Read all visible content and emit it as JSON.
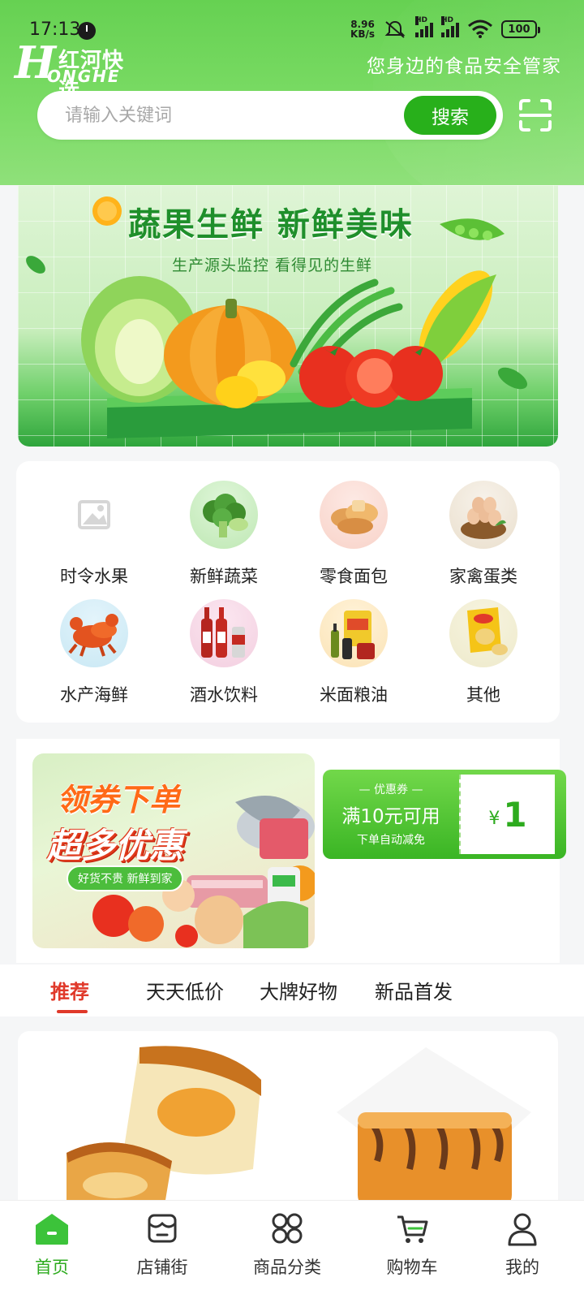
{
  "status_bar": {
    "time": "17:13",
    "net_speed_value": "8.96",
    "net_speed_unit": "KB/s",
    "battery": "100"
  },
  "header": {
    "logo_cn": "红河快选",
    "logo_en": "ONGHE",
    "logo_letter": "H",
    "slogan": "您身边的食品安全管家",
    "search_placeholder": "请输入关键词",
    "search_button": "搜索"
  },
  "banner": {
    "title": "蔬果生鲜 新鲜美味",
    "subtitle": "生产源头监控  看得见的生鲜"
  },
  "categories": [
    {
      "label": "时令水果",
      "icon": "image-placeholder-icon"
    },
    {
      "label": "新鲜蔬菜",
      "icon": "broccoli-icon"
    },
    {
      "label": "零食面包",
      "icon": "bread-icon"
    },
    {
      "label": "家禽蛋类",
      "icon": "eggs-icon"
    },
    {
      "label": "水产海鲜",
      "icon": "crab-icon"
    },
    {
      "label": "酒水饮料",
      "icon": "beer-bottles-icon"
    },
    {
      "label": "米面粮油",
      "icon": "rice-oil-icon"
    },
    {
      "label": "其他",
      "icon": "chips-icon"
    }
  ],
  "promo": {
    "line1": "领券下单",
    "line2": "超多优惠",
    "tag": "好货不贵 新鲜到家"
  },
  "coupon": {
    "kicker": "— 优惠券 —",
    "condition": "满10元可用",
    "note": "下单自动减免",
    "currency": "¥",
    "amount": "1"
  },
  "tabs": [
    {
      "label": "推荐",
      "active": true
    },
    {
      "label": "天天低价",
      "active": false
    },
    {
      "label": "大牌好物",
      "active": false
    },
    {
      "label": "新品首发",
      "active": false
    }
  ],
  "bottom_nav": [
    {
      "label": "首页",
      "icon": "home-icon",
      "active": true
    },
    {
      "label": "店铺街",
      "icon": "store-icon",
      "active": false
    },
    {
      "label": "商品分类",
      "icon": "category-icon",
      "active": false
    },
    {
      "label": "购物车",
      "icon": "cart-icon",
      "active": false
    },
    {
      "label": "我的",
      "icon": "user-icon",
      "active": false
    }
  ],
  "colors": {
    "brand_green": "#28b01b",
    "active_tab_red": "#e0392a"
  }
}
